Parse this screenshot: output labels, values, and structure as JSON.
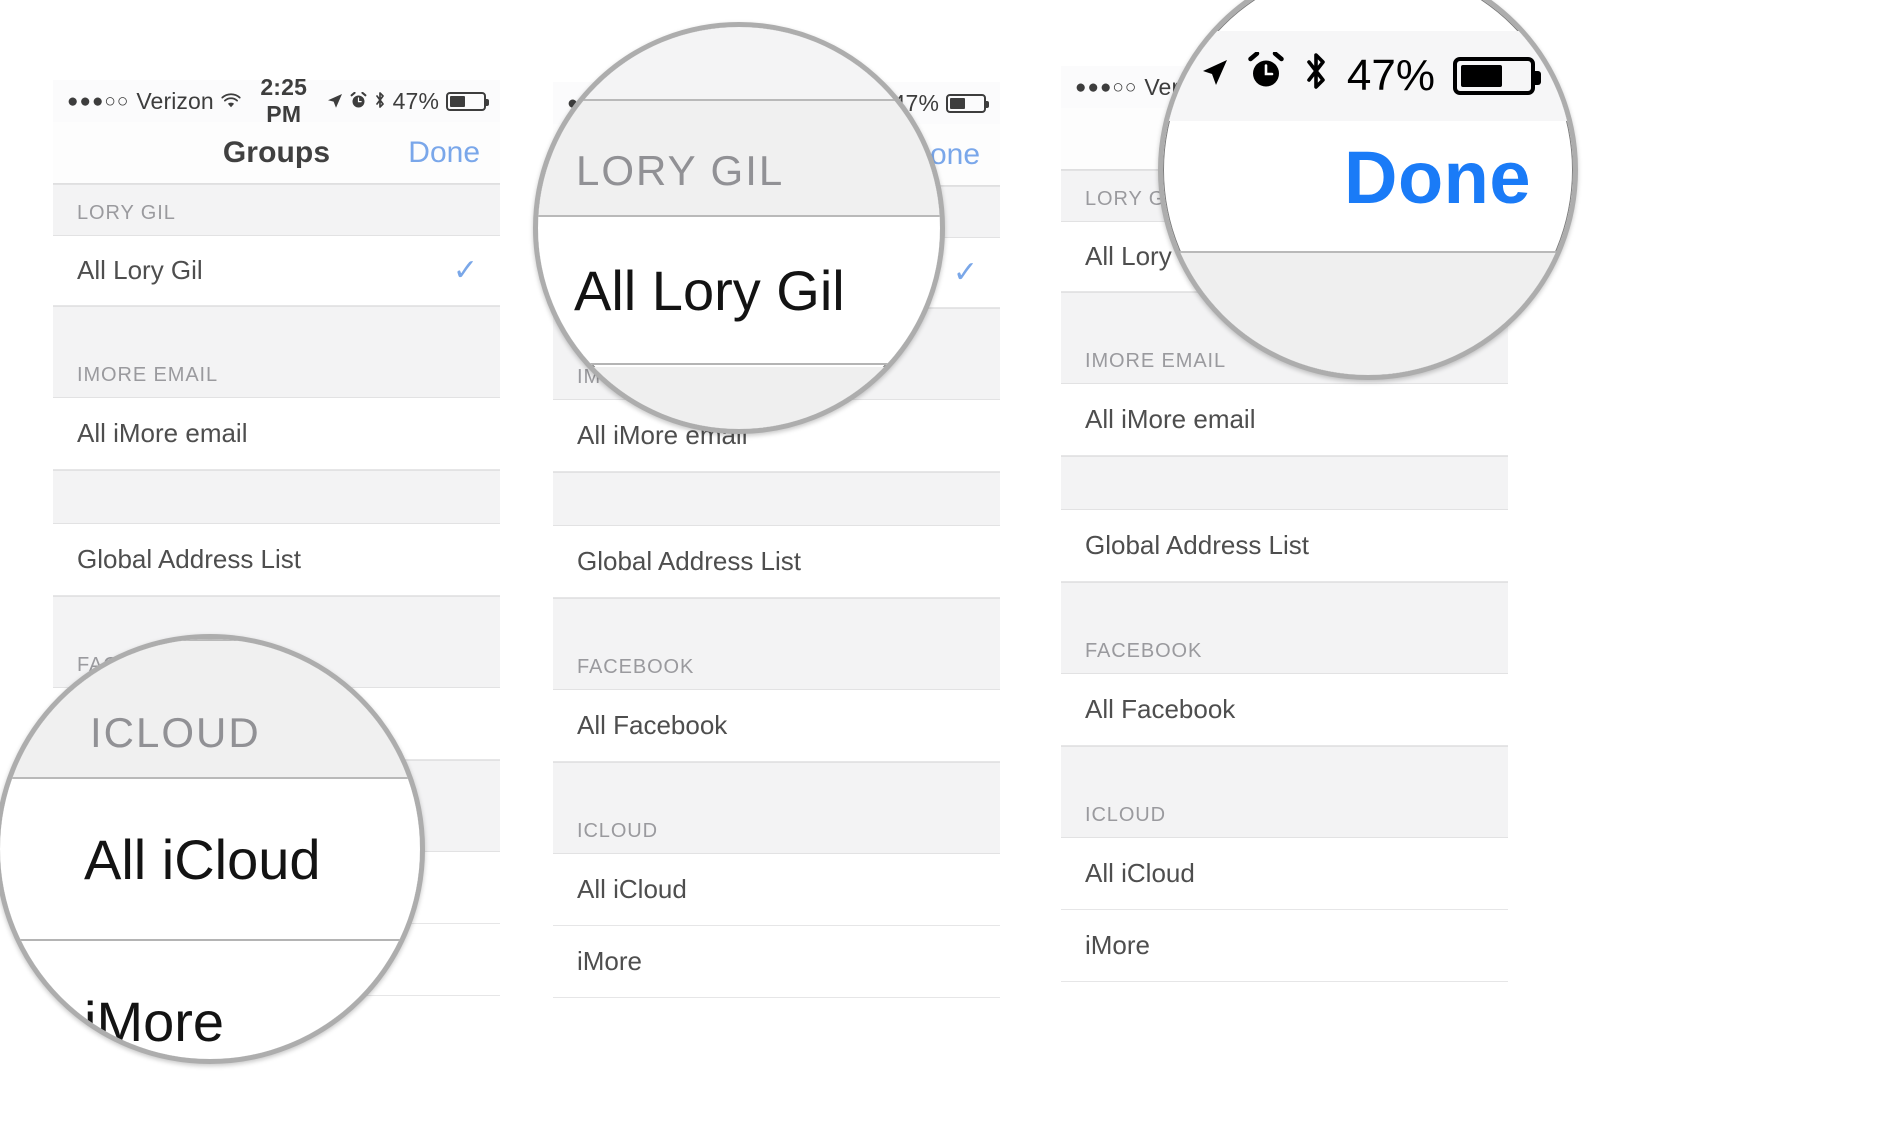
{
  "page": {
    "title": "iPhone Contacts Groups selection — three step screenshots",
    "accent_blue": "#7aa7ea",
    "magnifier_blue": "#1a7bf7",
    "check_blue": "#7aa7e8",
    "section_header_bg": "#f3f3f4",
    "row_bg": "#ffffff"
  },
  "status_bar": {
    "carrier_dots": "●●●○○",
    "carrier": "Verizon",
    "wifi_icon": "wifi-icon",
    "time": "2:25 PM",
    "location_icon": "location-arrow-icon",
    "alarm_icon": "alarm-clock-icon",
    "bluetooth_icon": "bluetooth-icon",
    "battery_percent": "47%",
    "battery_level": 47
  },
  "nav_bar": {
    "title": "Groups",
    "done_label": "Done"
  },
  "groups_list": [
    {
      "type": "header",
      "label": "LORY GIL"
    },
    {
      "type": "row",
      "label": "All Lory Gil",
      "checked": true
    },
    {
      "type": "header",
      "label": "IMORE EMAIL"
    },
    {
      "type": "row",
      "label": "All iMore email",
      "checked": false
    },
    {
      "type": "header",
      "label": ""
    },
    {
      "type": "row",
      "label": "Global Address List",
      "checked": false
    },
    {
      "type": "header",
      "label": "FACEBOOK"
    },
    {
      "type": "row",
      "label": "All Facebook",
      "checked": false
    },
    {
      "type": "header",
      "label": "ICLOUD"
    },
    {
      "type": "row",
      "label": "All iCloud",
      "checked": false
    },
    {
      "type": "row",
      "label": "iMore",
      "checked": false
    }
  ],
  "panels": [
    {
      "id": "panel-1",
      "magnifier": {
        "id": "magnifier-icloud",
        "header_label": "ICLOUD",
        "row_label": "All iCloud",
        "row_label_2": "iMore"
      }
    },
    {
      "id": "panel-2",
      "magnifier": {
        "id": "magnifier-all-lory-gil",
        "header_label": "LORY GIL",
        "row_label": "All Lory Gil"
      }
    },
    {
      "id": "panel-3",
      "magnifier": {
        "id": "magnifier-done",
        "done_label": "Done",
        "battery_percent": "47%",
        "alarm_icon": "alarm-clock-icon",
        "bluetooth_icon": "bluetooth-icon",
        "location_icon": "location-arrow-icon"
      }
    }
  ]
}
